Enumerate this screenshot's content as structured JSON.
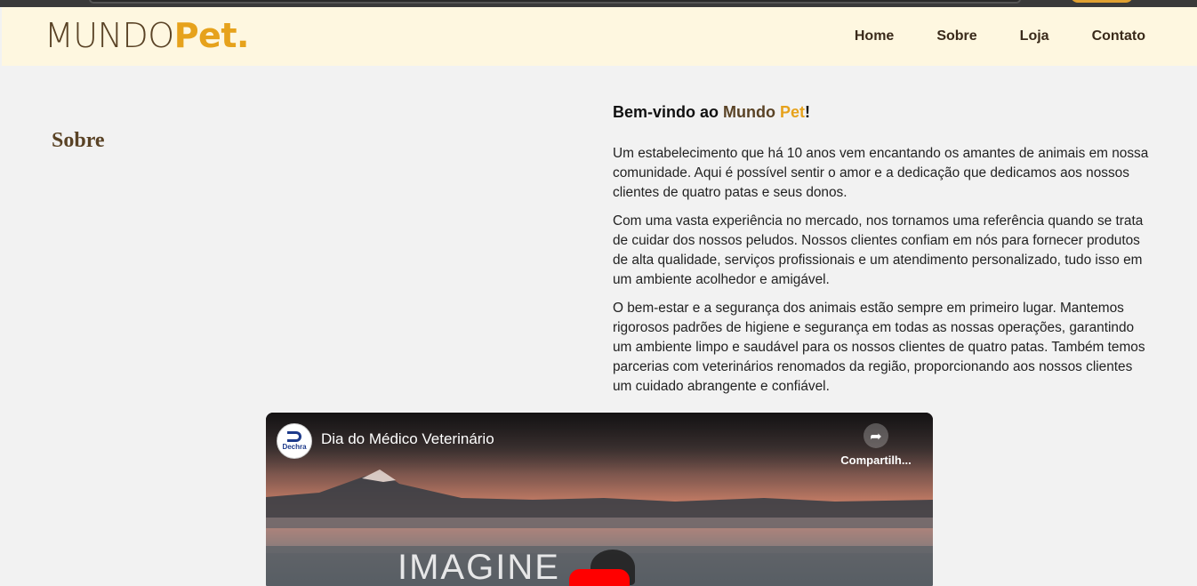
{
  "logo": {
    "part1": "MUNDO",
    "part2": "Pet."
  },
  "nav": {
    "items": [
      "Home",
      "Sobre",
      "Loja",
      "Contato"
    ]
  },
  "page": {
    "section_title": "Sobre"
  },
  "welcome": {
    "prefix": "Bem-vindo ao ",
    "mundo": "Mundo",
    "space": " ",
    "pet": "Pet",
    "suffix": "!"
  },
  "paragraphs": [
    "Um estabelecimento que há 10 anos vem encantando os amantes de animais em nossa comunidade. Aqui é possível sentir o amor e a dedicação que dedicamos aos nossos clientes de quatro patas e seus donos.",
    "Com uma vasta experiência no mercado, nos tornamos uma referência quando se trata de cuidar dos nossos peludos. Nossos clientes confiam em nós para fornecer produtos de alta qualidade, serviços profissionais e um atendimento personalizado, tudo isso em um ambiente acolhedor e amigável.",
    "O bem-estar e a segurança dos animais estão sempre em primeiro lugar. Mantemos rigorosos padrões de higiene e segurança em todas as nossas operações, garantindo um ambiente limpo e saudável para os nossos clientes de quatro patas. Também temos parcerias com veterinários renomados da região, proporcionando aos nossos clientes um cuidado abrangente e confiável."
  ],
  "video": {
    "channel_logo_text": "Dechra",
    "title": "Dia do Médico Veterinário",
    "share_label": "Compartilh...",
    "frame_text": "IMAGINE"
  },
  "colors": {
    "brand_brown": "#5a4326",
    "brand_orange": "#e6a21c",
    "header_bg": "#fef7e0",
    "youtube_red": "#ff0000"
  }
}
